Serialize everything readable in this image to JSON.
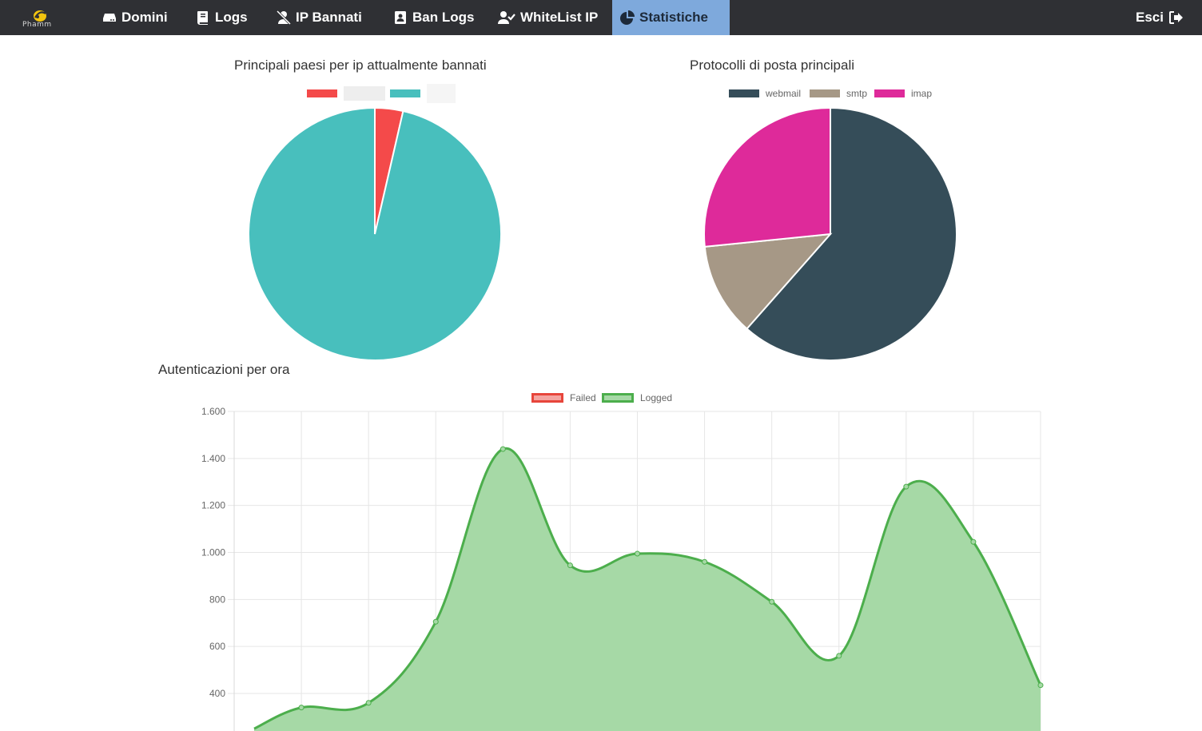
{
  "app": {
    "logo_text": "Phamm"
  },
  "nav": {
    "items": [
      {
        "label": "Domini",
        "icon": "hdd-icon"
      },
      {
        "label": "Logs",
        "icon": "book-icon"
      },
      {
        "label": "IP Bannati",
        "icon": "user-slash-icon"
      },
      {
        "label": "Ban Logs",
        "icon": "address-book-icon"
      },
      {
        "label": "WhiteList IP",
        "icon": "user-check-icon"
      },
      {
        "label": "Statistiche",
        "icon": "pie-chart-icon",
        "active": true
      }
    ],
    "logout_label": "Esci",
    "logout_icon": "sign-out-icon"
  },
  "colors": {
    "navbar": "#2f3034",
    "active_tab": "#7ea9dc"
  },
  "chart_data": [
    {
      "type": "pie",
      "title": "Principali paesi per ip attualmente bannati",
      "categories": [
        "",
        ""
      ],
      "values": [
        3.6,
        96.4
      ],
      "colors": [
        "#f44a4a",
        "#48bfbd"
      ]
    },
    {
      "type": "pie",
      "title": "Protocolli di posta principali",
      "categories": [
        "webmail",
        "smtp",
        "imap"
      ],
      "values": [
        61.5,
        11.9,
        26.6
      ],
      "colors": [
        "#354d59",
        "#a69886",
        "#de2a9a"
      ]
    },
    {
      "type": "area",
      "title": "Autenticazioni per ora",
      "series": [
        {
          "name": "Failed",
          "color": "#e7453b",
          "fill": "#f4a4a0",
          "values": []
        },
        {
          "name": "Logged",
          "color": "#4cae4c",
          "fill": "#a6d9a6",
          "values": [
            250,
            340,
            360,
            705,
            1440,
            945,
            995,
            960,
            790,
            560,
            1280,
            1045,
            435
          ]
        }
      ],
      "ylim": [
        0,
        1600
      ],
      "yticks": [
        "1.600",
        "1.400",
        "1.200",
        "1.000",
        "800",
        "600",
        "400"
      ],
      "ytick_values": [
        1600,
        1400,
        1200,
        1000,
        800,
        600,
        400
      ],
      "grid": true,
      "legend": "top"
    }
  ]
}
